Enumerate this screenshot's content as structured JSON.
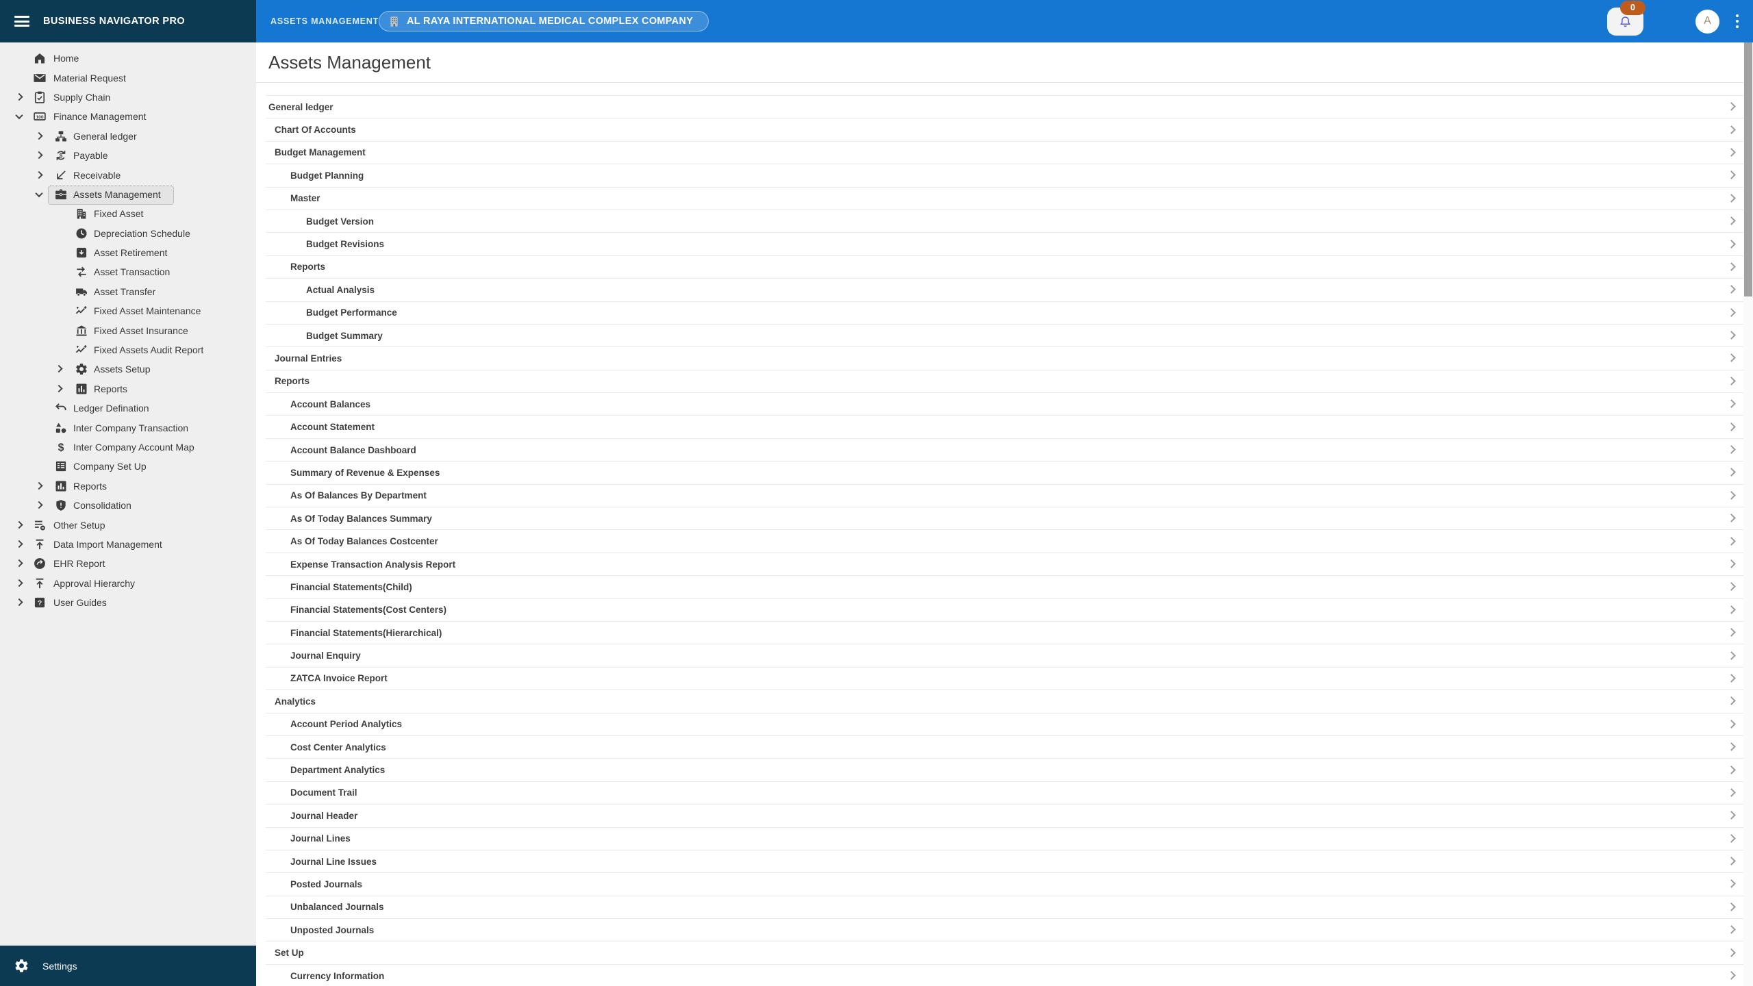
{
  "app": {
    "brand": "BUSINESS NAVIGATOR PRO",
    "header_label": "ASSETS MANAGEMENT",
    "company_chip": "AL RAYA INTERNATIONAL MEDICAL COMPLEX COMPANY",
    "notification_count": "0",
    "avatar_initial": "A"
  },
  "colors": {
    "navy": "#0d3a53",
    "blue": "#1677d3",
    "sidebar_bg": "#efefef",
    "badge_orange": "#bf5c1d",
    "bell_purple": "#5a5ad1",
    "row_text": "#3f3f3f"
  },
  "page": {
    "title": "Assets Management"
  },
  "sidebar": {
    "settings_label": "Settings",
    "items": [
      {
        "label": "Home",
        "level": 0,
        "icon": "home",
        "caret": null,
        "selected": false
      },
      {
        "label": "Material Request",
        "level": 0,
        "icon": "mail",
        "caret": null,
        "selected": false
      },
      {
        "label": "Supply Chain",
        "level": 0,
        "icon": "clipboard",
        "caret": "right",
        "selected": false
      },
      {
        "label": "Finance Management",
        "level": 0,
        "icon": "finance",
        "caret": "down",
        "selected": false
      },
      {
        "label": "General ledger",
        "level": 1,
        "icon": "tree",
        "caret": "right",
        "selected": false
      },
      {
        "label": "Payable",
        "level": 1,
        "icon": "exchange",
        "caret": "right",
        "selected": false
      },
      {
        "label": "Receivable",
        "level": 1,
        "icon": "arrow-received",
        "caret": "right",
        "selected": false
      },
      {
        "label": "Assets Management",
        "level": 1,
        "icon": "briefcase",
        "caret": "down",
        "selected": true
      },
      {
        "label": "Fixed Asset",
        "level": 2,
        "icon": "building",
        "caret": null,
        "selected": false
      },
      {
        "label": "Depreciation Schedule",
        "level": 2,
        "icon": "clock",
        "caret": null,
        "selected": false
      },
      {
        "label": "Asset Retirement",
        "level": 2,
        "icon": "archive-down",
        "caret": null,
        "selected": false
      },
      {
        "label": "Asset Transaction",
        "level": 2,
        "icon": "arrows-swap",
        "caret": null,
        "selected": false
      },
      {
        "label": "Asset Transfer",
        "level": 2,
        "icon": "truck",
        "caret": null,
        "selected": false
      },
      {
        "label": "Fixed Asset Maintenance",
        "level": 2,
        "icon": "chart-sparkle",
        "caret": null,
        "selected": false
      },
      {
        "label": "Fixed Asset Insurance",
        "level": 2,
        "icon": "bank",
        "caret": null,
        "selected": false
      },
      {
        "label": "Fixed Assets Audit Report",
        "level": 2,
        "icon": "chart-sparkle",
        "caret": null,
        "selected": false
      },
      {
        "label": "Assets Setup",
        "level": 2,
        "icon": "gear",
        "caret": "right",
        "selected": false
      },
      {
        "label": "Reports",
        "level": 2,
        "icon": "bar-chart",
        "caret": "right",
        "selected": false
      },
      {
        "label": "Ledger Defination",
        "level": 1,
        "icon": "undo",
        "caret": null,
        "selected": false
      },
      {
        "label": "Inter Company Transaction",
        "level": 1,
        "icon": "shapes",
        "caret": null,
        "selected": false
      },
      {
        "label": "Inter Company Account Map",
        "level": 1,
        "icon": "dollar",
        "caret": null,
        "selected": false
      },
      {
        "label": "Company Set Up",
        "level": 1,
        "icon": "ledger-book",
        "caret": null,
        "selected": false
      },
      {
        "label": "Reports",
        "level": 1,
        "icon": "bar-chart",
        "caret": "right",
        "selected": false
      },
      {
        "label": "Consolidation",
        "level": 1,
        "icon": "shield",
        "caret": "right",
        "selected": false
      },
      {
        "label": "Other Setup",
        "level": 0,
        "icon": "list-gear",
        "caret": "right",
        "selected": false
      },
      {
        "label": "Data Import Management",
        "level": 0,
        "icon": "upload",
        "caret": "right",
        "selected": false
      },
      {
        "label": "EHR Report",
        "level": 0,
        "icon": "redo-circle",
        "caret": "right",
        "selected": false
      },
      {
        "label": "Approval Hierarchy",
        "level": 0,
        "icon": "upload",
        "caret": "right",
        "selected": false
      },
      {
        "label": "User Guides",
        "level": 0,
        "icon": "question",
        "caret": "right",
        "selected": false
      }
    ]
  },
  "tree": {
    "rows": [
      {
        "label": "General ledger",
        "level": 0
      },
      {
        "label": "Chart Of Accounts",
        "level": 1
      },
      {
        "label": "Budget Management",
        "level": 1
      },
      {
        "label": "Budget Planning",
        "level": 2
      },
      {
        "label": "Master",
        "level": 2
      },
      {
        "label": "Budget Version",
        "level": 3
      },
      {
        "label": "Budget Revisions",
        "level": 3
      },
      {
        "label": "Reports",
        "level": 2
      },
      {
        "label": "Actual Analysis",
        "level": 3
      },
      {
        "label": "Budget Performance",
        "level": 3
      },
      {
        "label": "Budget Summary",
        "level": 3
      },
      {
        "label": "Journal Entries",
        "level": 1
      },
      {
        "label": "Reports",
        "level": 1
      },
      {
        "label": "Account Balances",
        "level": 2
      },
      {
        "label": "Account Statement",
        "level": 2
      },
      {
        "label": "Account Balance Dashboard",
        "level": 2
      },
      {
        "label": "Summary of Revenue & Expenses",
        "level": 2
      },
      {
        "label": "As Of Balances By Department",
        "level": 2
      },
      {
        "label": "As Of Today Balances Summary",
        "level": 2
      },
      {
        "label": "As Of Today Balances Costcenter",
        "level": 2
      },
      {
        "label": "Expense Transaction Analysis Report",
        "level": 2
      },
      {
        "label": "Financial Statements(Child)",
        "level": 2
      },
      {
        "label": "Financial Statements(Cost Centers)",
        "level": 2
      },
      {
        "label": "Financial Statements(Hierarchical)",
        "level": 2
      },
      {
        "label": "Journal Enquiry",
        "level": 2
      },
      {
        "label": "ZATCA Invoice Report",
        "level": 2
      },
      {
        "label": "Analytics",
        "level": 1
      },
      {
        "label": "Account Period Analytics",
        "level": 2
      },
      {
        "label": "Cost Center Analytics",
        "level": 2
      },
      {
        "label": "Department Analytics",
        "level": 2
      },
      {
        "label": "Document Trail",
        "level": 2
      },
      {
        "label": "Journal Header",
        "level": 2
      },
      {
        "label": "Journal Lines",
        "level": 2
      },
      {
        "label": "Journal Line Issues",
        "level": 2
      },
      {
        "label": "Posted Journals",
        "level": 2
      },
      {
        "label": "Unbalanced Journals",
        "level": 2
      },
      {
        "label": "Unposted Journals",
        "level": 2
      },
      {
        "label": "Set Up",
        "level": 1
      },
      {
        "label": "Currency Information",
        "level": 2
      }
    ]
  }
}
